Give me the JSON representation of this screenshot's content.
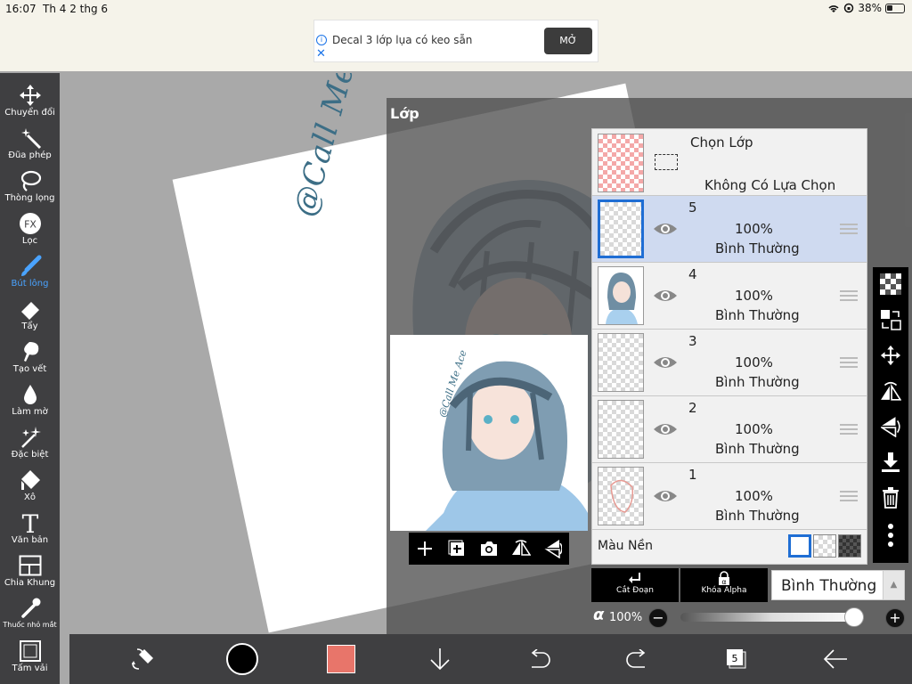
{
  "status": {
    "time": "16:07",
    "date": "Th 4 2 thg 6",
    "battery": "38%"
  },
  "ad": {
    "text": "Decal 3 lớp lụa có keo sẵn",
    "button": "MỞ",
    "close": "✕",
    "info": "i"
  },
  "toolbar": {
    "tools": [
      {
        "label": "Chuyển đổi",
        "icon": "move-icon"
      },
      {
        "label": "Đũa phép",
        "icon": "magic-wand-icon"
      },
      {
        "label": "Thòng lọng",
        "icon": "lasso-icon"
      },
      {
        "label": "Lọc",
        "icon": "fx-icon"
      },
      {
        "label": "Bút lông",
        "icon": "brush-icon",
        "active": true
      },
      {
        "label": "Tẩy",
        "icon": "eraser-icon"
      },
      {
        "label": "Tạo vết",
        "icon": "smudge-icon"
      },
      {
        "label": "Làm mờ",
        "icon": "blur-drop-icon"
      },
      {
        "label": "Đặc biệt",
        "icon": "special-sparkle-icon"
      },
      {
        "label": "Xô",
        "icon": "bucket-icon"
      },
      {
        "label": "Văn bản",
        "icon": "text-icon"
      },
      {
        "label": "Chia Khung",
        "icon": "frame-divider-icon"
      },
      {
        "label": "Thuốc nhỏ mắt",
        "icon": "eyedropper-icon"
      },
      {
        "label": "Tấm vải",
        "icon": "canvas-icon"
      }
    ],
    "fx_glyph": "FX",
    "text_glyph": "T"
  },
  "canvas": {
    "signature": "@Call Me Ace"
  },
  "layers_panel": {
    "title": "Lớp",
    "selection": {
      "title": "Chọn Lớp",
      "subtitle": "Không Có Lựa Chọn"
    },
    "layers": [
      {
        "number": "5",
        "opacity": "100%",
        "mode": "Bình Thường",
        "selected": true
      },
      {
        "number": "4",
        "opacity": "100%",
        "mode": "Bình Thường",
        "selected": false
      },
      {
        "number": "3",
        "opacity": "100%",
        "mode": "Bình Thường",
        "selected": false
      },
      {
        "number": "2",
        "opacity": "100%",
        "mode": "Bình Thường",
        "selected": false
      },
      {
        "number": "1",
        "opacity": "100%",
        "mode": "Bình Thường",
        "selected": false
      }
    ],
    "background": {
      "label": "Màu Nền"
    },
    "clipping_label": "Cắt Đoạn",
    "alpha_lock_label": "Khóa Alpha",
    "alpha_glyph": "α",
    "blend_mode": "Bình Thường",
    "opacity_symbol": "α",
    "opacity_value": "100%",
    "opacity_fraction": 1.0,
    "minus": "−",
    "plus": "+"
  },
  "bottombar": {
    "layer_count": "5",
    "primary_color": "#000000",
    "secondary_color": "#e8756a"
  },
  "colors": {
    "toolbar_bg": "#3f3f41",
    "accent_blue": "#1f6ed4",
    "selected_row": "#cfdaf0"
  }
}
